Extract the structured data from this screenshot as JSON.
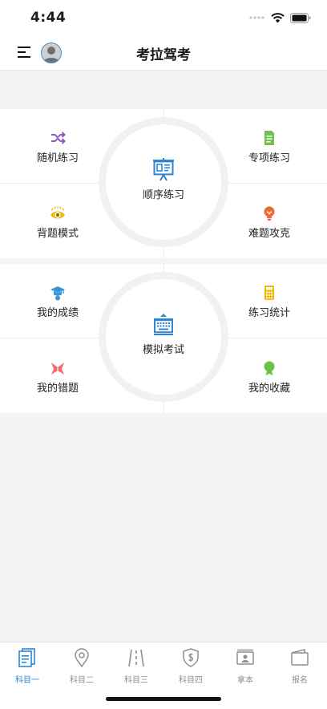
{
  "status_bar": {
    "time": "4:44"
  },
  "nav": {
    "title": "考拉驾考",
    "menu_icon": "menu-icon",
    "avatar_icon": "avatar-icon"
  },
  "sections": [
    {
      "center": {
        "label": "顺序练习",
        "icon": "presentation-board-icon",
        "color": "#2f86d6"
      },
      "top_left": {
        "label": "随机练习",
        "icon": "shuffle-icon",
        "color": "#8e56c8"
      },
      "top_right": {
        "label": "专项练习",
        "icon": "document-icon",
        "color": "#6cc24a"
      },
      "bottom_left": {
        "label": "背题模式",
        "icon": "eye-icon",
        "color": "#f2b705"
      },
      "bottom_right": {
        "label": "难题攻克",
        "icon": "lightbulb-icon",
        "color": "#ee6a2f"
      }
    },
    {
      "center": {
        "label": "模拟考试",
        "icon": "keyboard-icon",
        "color": "#2f86d6"
      },
      "top_left": {
        "label": "我的成绩",
        "icon": "graduation-cap-icon",
        "color": "#3a93d8"
      },
      "top_right": {
        "label": "练习统计",
        "icon": "calculator-icon",
        "color": "#f2b705"
      },
      "bottom_left": {
        "label": "我的错题",
        "icon": "bookmark-x-icon",
        "color": "#f06b6b"
      },
      "bottom_right": {
        "label": "我的收藏",
        "icon": "medal-icon",
        "color": "#6cc24a"
      }
    }
  ],
  "tabs": [
    {
      "label": "科目一",
      "icon": "documents-icon",
      "active": true
    },
    {
      "label": "科目二",
      "icon": "location-pin-icon",
      "active": false
    },
    {
      "label": "科目三",
      "icon": "road-icon",
      "active": false
    },
    {
      "label": "科目四",
      "icon": "shield-dollar-icon",
      "active": false
    },
    {
      "label": "拿本",
      "icon": "license-card-icon",
      "active": false
    },
    {
      "label": "报名",
      "icon": "wallet-icon",
      "active": false
    }
  ],
  "colors": {
    "accent": "#2f86d6",
    "inactive": "#8e8e93",
    "background": "#f4f4f4"
  }
}
